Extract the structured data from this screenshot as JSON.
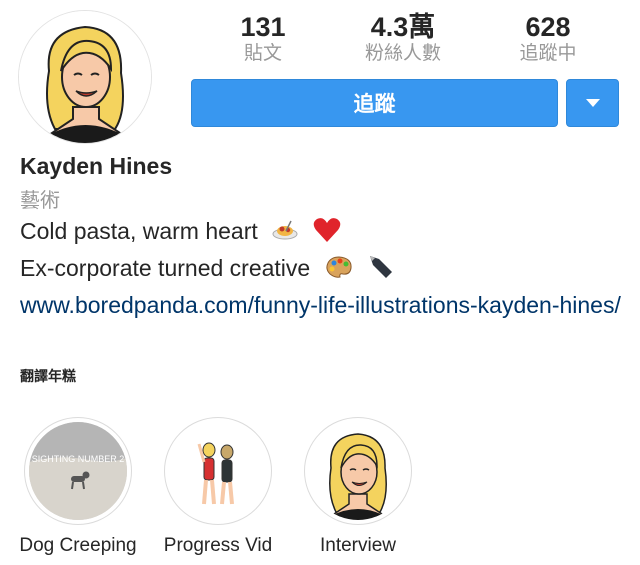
{
  "profile": {
    "username": "Kayden Hines",
    "category": "藝術",
    "bio_lines": [
      "Cold pasta, warm heart",
      "Ex-corporate turned creative"
    ],
    "link": "www.boredpanda.com/funny-life-illustrations-kayden-hines/",
    "translate_label": "翻譯年糕"
  },
  "stats": {
    "posts": {
      "value": "131",
      "label": "貼文"
    },
    "followers": {
      "value": "4.3萬",
      "label": "粉絲人數"
    },
    "following": {
      "value": "628",
      "label": "追蹤中"
    }
  },
  "actions": {
    "follow_label": "追蹤"
  },
  "highlights": [
    {
      "label": "Dog Creeping",
      "overlay_text": "SIGHTING NUMBER 2"
    },
    {
      "label": "Progress Vid"
    },
    {
      "label": "Interview"
    }
  ],
  "colors": {
    "button_blue": "#3897f0",
    "link_color": "#003569",
    "muted": "#999999"
  },
  "icons": [
    "spaghetti-emoji",
    "heart-emoji",
    "palette-emoji",
    "pen-nib-emoji",
    "dropdown-caret-icon"
  ]
}
